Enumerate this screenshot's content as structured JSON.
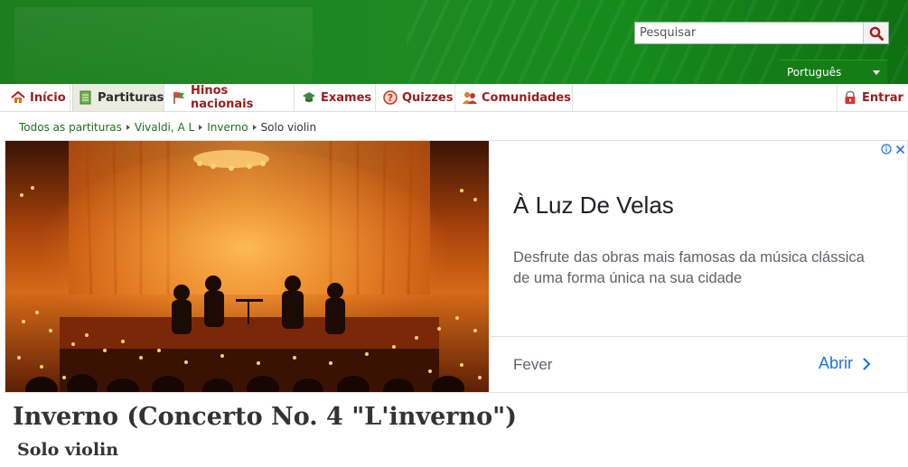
{
  "header": {
    "search": {
      "placeholder": "Pesquisar"
    },
    "language": {
      "selected": "Português"
    }
  },
  "nav": {
    "items": [
      {
        "label": "Início",
        "icon": "home-icon"
      },
      {
        "label": "Partituras",
        "icon": "sheet-music-icon",
        "active": true
      },
      {
        "label": "Hinos nacionais",
        "icon": "flag-icon"
      },
      {
        "label": "Exames",
        "icon": "graduation-cap-icon"
      },
      {
        "label": "Quizzes",
        "icon": "question-icon"
      },
      {
        "label": "Comunidades",
        "icon": "people-icon"
      }
    ],
    "login": {
      "label": "Entrar",
      "icon": "lock-icon"
    }
  },
  "breadcrumb": {
    "items": [
      "Todos as partituras",
      "Vivaldi, A L",
      "Inverno"
    ],
    "current": "Solo violin"
  },
  "ad": {
    "title": "À Luz De Velas",
    "description": "Desfrute das obras mais famosas da música clássica de uma forma única na sua cidade",
    "advertiser": "Fever",
    "cta": "Abrir",
    "accent": "#1a73e8"
  },
  "page": {
    "title": "Inverno (Concerto No. 4 \"L'inverno\")",
    "subtitle": "Solo violin"
  },
  "colors": {
    "header_green": "#1d8a22",
    "nav_text": "#9b1b1b",
    "link_green": "#1f6f1f"
  }
}
